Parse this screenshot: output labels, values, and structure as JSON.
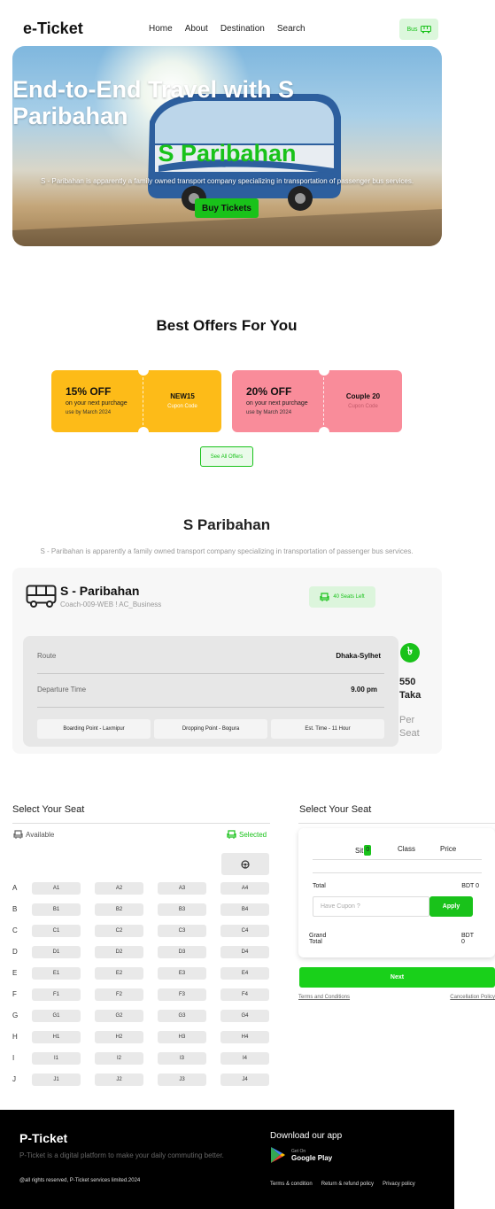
{
  "nav": {
    "logo": "e-Ticket",
    "links": [
      "Home",
      "About",
      "Destination",
      "Search"
    ],
    "bus_button": "Bus"
  },
  "hero": {
    "title": "End-to-End Travel with S Paribahan",
    "subtitle": "S Paribahan",
    "description": "S - Paribahan is apparently a family owned transport company specializing in transportation of passenger bus services.",
    "button": "Buy Tickets"
  },
  "offers": {
    "title": "Best Offers For You",
    "items": [
      {
        "percent": "15% OFF",
        "line1": "on your next purchage",
        "line2": "use by March 2024",
        "code": "NEW15",
        "code_label": "Cupon Code",
        "color": "#fdbb18"
      },
      {
        "percent": "20% OFF",
        "line1": "on your next purchage",
        "line2": "use by March 2024",
        "code": "Couple 20",
        "code_label": "Cupon Code",
        "color": "#f98c9a"
      }
    ],
    "see_all": "See All Offers"
  },
  "operator": {
    "title": "S Paribahan",
    "description": "S - Paribahan is apparently a family owned transport company specializing in transportation of passenger bus services.",
    "name": "S - Paribahan",
    "coach": "Coach-009-WEB ! AC_Business",
    "seats_left": "40 Seats Left",
    "route_label": "Route",
    "route_value": "Dhaka-Sylhet",
    "departure_label": "Departure Time",
    "departure_value": "9.00 pm",
    "boarding": "Boarding Point - Laxmipur",
    "dropping": "Dropping Point - Bogura",
    "est_time": "Est. Time - 11 Hour",
    "currency_icon": "৳",
    "price": "550 Taka",
    "per_seat": "Per Seat"
  },
  "seat_section": {
    "title": "Select Your Seat",
    "available": "Available",
    "selected": "Selected",
    "rows": [
      "A",
      "B",
      "C",
      "D",
      "E",
      "F",
      "G",
      "H",
      "I",
      "J"
    ],
    "columns": [
      "1",
      "2",
      "3",
      "4"
    ]
  },
  "summary": {
    "title": "Select Your Seat",
    "col_sit": "Sit",
    "sit_count": "0",
    "col_class": "Class",
    "col_price": "Price",
    "total_label": "Total",
    "total_value": "BDT 0",
    "cupon_placeholder": "Have Cupon ?",
    "apply": "Apply",
    "grand_label_1": "Grand",
    "grand_label_2": "Total",
    "grand_value_1": "BDT",
    "grand_value_2": "0",
    "next": "Next",
    "terms": "Terms and Conditions",
    "cancellation": "Cancellation Policy"
  },
  "footer": {
    "logo": "P-Ticket",
    "description": "P-Ticket is a digital platform to make your daily commuting better.",
    "copyright": "@all rights reserved, P-Ticket services limited.2024",
    "download": "Download our app",
    "get_on": "Get On",
    "store": "Google Play",
    "links": [
      "Terms & condition",
      "Return & refund policy",
      "Privacy policy"
    ]
  },
  "colors": {
    "accent": "#19c21a",
    "dark": "#000000"
  }
}
